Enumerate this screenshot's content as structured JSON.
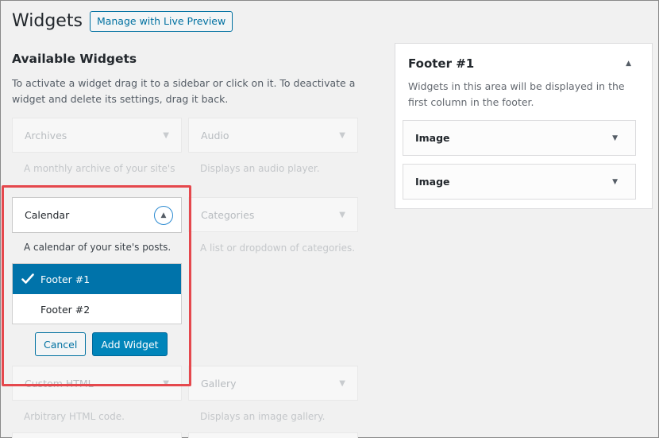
{
  "header": {
    "title": "Widgets",
    "live_preview_label": "Manage with Live Preview"
  },
  "available": {
    "title": "Available Widgets",
    "description": "To activate a widget drag it to a sidebar or click on it. To deactivate a widget and delete its settings, drag it back."
  },
  "widgets": {
    "archives": {
      "title": "Archives",
      "desc": "A monthly archive of your site's Posts."
    },
    "audio": {
      "title": "Audio",
      "desc": "Displays an audio player."
    },
    "calendar": {
      "title": "Calendar",
      "desc": "A calendar of your site's posts."
    },
    "categories": {
      "title": "Categories",
      "desc": "A list or dropdown of categories."
    },
    "custom_html": {
      "title": "Custom HTML",
      "desc": "Arbitrary HTML code."
    },
    "gallery": {
      "title": "Gallery",
      "desc": "Displays an image gallery."
    }
  },
  "chooser": {
    "options": [
      "Footer #1",
      "Footer #2"
    ],
    "selected": "Footer #1",
    "cancel_label": "Cancel",
    "add_label": "Add Widget"
  },
  "sidebar": {
    "title": "Footer #1",
    "description": "Widgets in this area will be displayed in the first column in the footer.",
    "widgets": [
      "Image",
      "Image"
    ]
  },
  "icons": {
    "collapse": "arrow-up-icon",
    "expand": "arrow-down-icon",
    "check": "check-icon"
  },
  "colors": {
    "accent": "#0073aa",
    "highlight_frame": "#e5484d"
  }
}
